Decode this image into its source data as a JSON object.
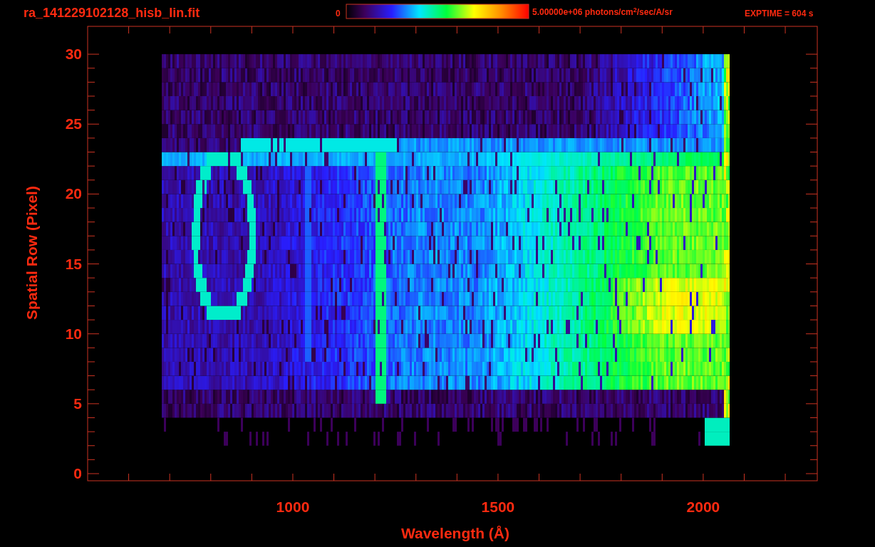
{
  "plot": {
    "title": "ra_141229102128_hisb_lin.fit",
    "colorbar": {
      "min_label": "0",
      "max_label": "5.00000e+06 photons/cm$^{2}$/sec/A/sr"
    },
    "exposure": "EXPTIME = 604 s",
    "y_axis": {
      "label": "Spatial Row (Pixel)",
      "ticks": [
        "30",
        "25",
        "20",
        "15",
        "10",
        "5",
        "0"
      ]
    },
    "x_axis": {
      "label": "Wavelength (Å)",
      "ticks": [
        "1000",
        "1500",
        "2000"
      ]
    }
  }
}
